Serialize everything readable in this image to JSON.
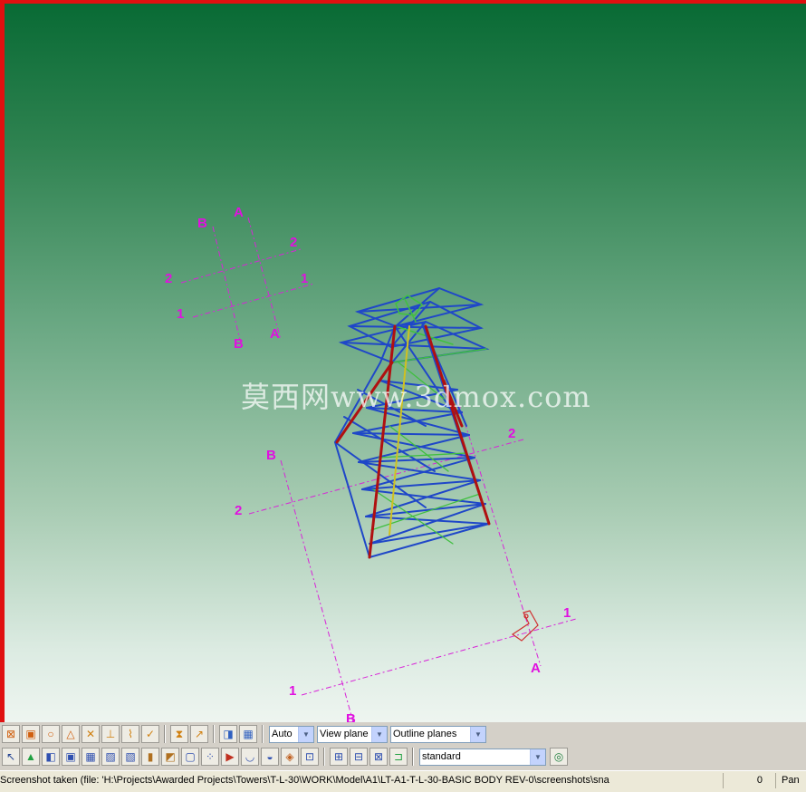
{
  "viewport": {
    "grid_labels": {
      "small": [
        "B",
        "A",
        "2",
        "2",
        "1",
        "1",
        "B",
        "A"
      ],
      "large": [
        "B",
        "2",
        "2",
        "1",
        "1",
        "A",
        "B"
      ]
    },
    "watermark": "莫西网www.3dmox.com"
  },
  "toolbar1": {
    "buttons": [
      {
        "icon": "snap-reference-icon",
        "glyph": "⊠",
        "color": "#d06010"
      },
      {
        "icon": "snap-geometry-icon",
        "glyph": "▣",
        "color": "#d06010"
      },
      {
        "icon": "snap-circle-icon",
        "glyph": "○",
        "color": "#d06010"
      },
      {
        "icon": "snap-triangle-icon",
        "glyph": "△",
        "color": "#d06010"
      },
      {
        "icon": "snap-cross-icon",
        "glyph": "✕",
        "color": "#d08010"
      },
      {
        "icon": "snap-perpendicular-icon",
        "glyph": "⊥",
        "color": "#d08010"
      },
      {
        "icon": "snap-free-icon",
        "glyph": "⌇",
        "color": "#d08010"
      },
      {
        "icon": "snap-check-icon",
        "glyph": "✓",
        "color": "#d08010"
      },
      {
        "icon": "snap-hourglass-icon",
        "glyph": "⧗",
        "color": "#d08010"
      },
      {
        "icon": "snap-arrow-icon",
        "glyph": "↗",
        "color": "#d08010"
      },
      {
        "icon": "render-icon",
        "glyph": "◨",
        "color": "#3060c0"
      },
      {
        "icon": "grid-view-icon",
        "glyph": "▦",
        "color": "#3060c0"
      }
    ],
    "combo_snap": "Auto",
    "combo_plane": "View plane",
    "combo_outline": "Outline planes"
  },
  "toolbar2": {
    "buttons": [
      {
        "icon": "select-pointer-icon",
        "glyph": "↖",
        "color": "#204090"
      },
      {
        "icon": "select-part-icon",
        "glyph": "▲",
        "color": "#20a040"
      },
      {
        "icon": "select-object-icon",
        "glyph": "◧",
        "color": "#3050b0"
      },
      {
        "icon": "select-assembly-icon",
        "glyph": "▣",
        "color": "#3050b0"
      },
      {
        "icon": "select-grid-icon",
        "glyph": "▦",
        "color": "#3050b0"
      },
      {
        "icon": "select-weld-icon",
        "glyph": "▨",
        "color": "#3050b0"
      },
      {
        "icon": "select-bolt-icon",
        "glyph": "▧",
        "color": "#3050b0"
      },
      {
        "icon": "select-component-icon",
        "glyph": "▮",
        "color": "#b07020"
      },
      {
        "icon": "select-detail-icon",
        "glyph": "◩",
        "color": "#b07020"
      },
      {
        "icon": "select-plane-icon",
        "glyph": "▢",
        "color": "#3050b0"
      },
      {
        "icon": "select-points-icon",
        "glyph": "⁘",
        "color": "#3050b0"
      },
      {
        "icon": "select-reference-icon",
        "glyph": "▶",
        "color": "#c03020"
      },
      {
        "icon": "select-cut-icon",
        "glyph": "◡",
        "color": "#3050b0"
      },
      {
        "icon": "select-surface-icon",
        "glyph": "◒",
        "color": "#3050b0"
      },
      {
        "icon": "select-fitting-icon",
        "glyph": "◈",
        "color": "#c06020"
      },
      {
        "icon": "select-group-icon",
        "glyph": "⊡",
        "color": "#3050b0"
      },
      {
        "icon": "select-sub-icon",
        "glyph": "⊞",
        "color": "#3050b0"
      },
      {
        "icon": "select-multi-icon",
        "glyph": "⊟",
        "color": "#3050b0"
      },
      {
        "icon": "select-all-icon",
        "glyph": "⊠",
        "color": "#3050b0"
      },
      {
        "icon": "select-weld-marks-icon",
        "glyph": "⊐",
        "color": "#20a040"
      }
    ],
    "combo_filter": "standard",
    "filter_button_icon": "select-filter-icon"
  },
  "status": {
    "message": "Screenshot taken (file: 'H:\\Projects\\Awarded Projects\\Towers\\T-L-30\\WORK\\Model\\A1\\LT-A1-T-L-30-BASIC BODY REV-0\\screenshots\\sna",
    "coord": "0",
    "mode": "Pan"
  },
  "colors": {
    "border_accent": "#e01010",
    "grid_label": "#e010e0",
    "tower_blue": "#1f47c8",
    "tower_green": "#40c040",
    "tower_red": "#b01010"
  }
}
